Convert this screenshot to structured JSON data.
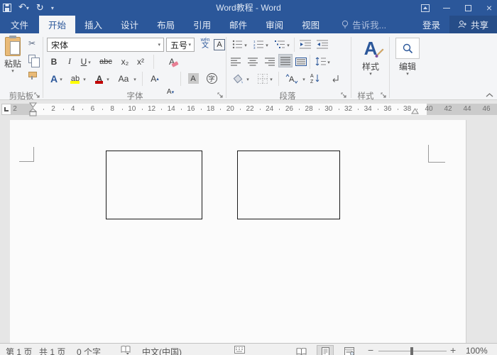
{
  "titlebar": {
    "title": "Word教程 - Word"
  },
  "tabs": {
    "file": "文件",
    "items": [
      "开始",
      "插入",
      "设计",
      "布局",
      "引用",
      "邮件",
      "审阅",
      "视图"
    ],
    "active": "开始",
    "tell_me": "告诉我...",
    "sign_in": "登录",
    "share": "共享"
  },
  "ribbon": {
    "clipboard": {
      "paste": "粘贴",
      "label": "剪贴板"
    },
    "font": {
      "font_name": "宋体",
      "font_size": "五号",
      "bold": "B",
      "italic": "I",
      "underline": "U",
      "strikethrough": "abc",
      "subscript": "x₂",
      "superscript": "x²",
      "clear_format": "A",
      "text_effects": "A",
      "highlight": "ab",
      "font_color": "A",
      "change_case": "Aa",
      "grow_font": "A",
      "shrink_font": "A",
      "char_shading": "A",
      "enclose_char": "字",
      "phonetic_top": "wén",
      "phonetic_bottom": "文",
      "char_border": "A",
      "label": "字体"
    },
    "paragraph": {
      "sort_a": "A",
      "sort_z": "Z",
      "asian_a": "A",
      "label": "段落"
    },
    "styles": {
      "button": "样式",
      "icon_letter": "A",
      "label": "样式"
    },
    "editing": {
      "button": "编辑"
    }
  },
  "ruler": {
    "left_label": "2",
    "numbers": [
      "2",
      "4",
      "6",
      "8",
      "10",
      "12",
      "14",
      "16",
      "18",
      "20",
      "22",
      "24",
      "26",
      "28",
      "30",
      "32",
      "34",
      "36",
      "38"
    ],
    "right_numbers": [
      "40",
      "42",
      "44",
      "46"
    ]
  },
  "document": {
    "shape_count": 2
  },
  "statusbar": {
    "page": "第 1 页",
    "total_pages": "共 1 页",
    "word_count": "0 个字",
    "language": "中文(中国)",
    "zoom_out": "−",
    "zoom_in": "+",
    "zoom_level": "100%"
  },
  "icons": {
    "save": "save-icon",
    "undo": "↶",
    "redo": "↻",
    "caret_down": "▾",
    "scissors": "✂",
    "paragraph_mark": "↵",
    "colors": {
      "titlebar_blue": "#2b579a",
      "ribbon_bg": "#f4f5f7",
      "highlight_yellow": "#ffff00",
      "font_color_red": "#c00000",
      "clipboard_tan": "#e9ba77"
    }
  }
}
